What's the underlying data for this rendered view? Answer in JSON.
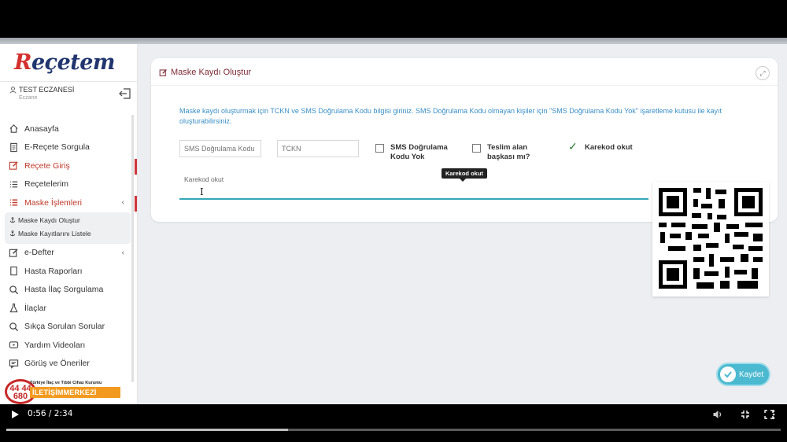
{
  "player": {
    "time_text": "0:56 / 2:34",
    "progress_fraction": 0.364
  },
  "app": {
    "logo_r": "R",
    "logo_rest": "eçetem"
  },
  "user": {
    "name": "TEST ECZANESİ",
    "role": "Eczane"
  },
  "menu": {
    "items": [
      {
        "label": "Anasayfa",
        "icon": "home-icon"
      },
      {
        "label": "E-Reçete Sorgula",
        "icon": "document-icon"
      },
      {
        "label": "Reçete Giriş",
        "icon": "edit-icon"
      },
      {
        "label": "Reçetelerim",
        "icon": "list-icon"
      },
      {
        "label": "Maske İşlemleri",
        "icon": "list-icon"
      },
      {
        "label": "e-Defter",
        "icon": "edit-icon"
      },
      {
        "label": "Hasta Raporları",
        "icon": "document-icon"
      },
      {
        "label": "Hasta İlaç Sorgulama",
        "icon": "search-icon"
      },
      {
        "label": "İlaçlar",
        "icon": "flask-icon"
      },
      {
        "label": "Sıkça Sorulan Sorular",
        "icon": "search-icon"
      },
      {
        "label": "Yardım Videoları",
        "icon": "video-icon"
      },
      {
        "label": "Görüş ve Öneriler",
        "icon": "chat-icon"
      }
    ],
    "submenu": [
      {
        "label": "Maske Kaydı Oluştur"
      },
      {
        "label": "Maske Kayıtlarını Listele"
      }
    ]
  },
  "contact": {
    "number_top": "44 44",
    "number_bottom": "680",
    "tagline": "Türkiye İlaç ve Tıbbi Cihaz Kurumu",
    "label": "İLETİŞİMMERKEZİ"
  },
  "card": {
    "title": "Maske Kaydı Oluştur",
    "info": "Maske kaydı oluşturmak için TCKN ve SMS Doğrulama Kodu bilgisi giriniz. SMS Doğrulama Kodu olmayan kişiler için \"SMS Doğrulama Kodu Yok\" işaretleme kutusu ile kayıt oluşturabilirsiniz.",
    "sms_placeholder": "SMS Doğrulama Kodu",
    "tckn_placeholder": "TCKN",
    "chk_sms_line1": "SMS Doğrulama",
    "chk_sms_line2": "Kodu Yok",
    "chk_teslim_line1": "Teslim alan",
    "chk_teslim_line2": "başkası mı?",
    "karekod_check_label": "Karekod okut",
    "karekod_field_label": "Karekod okut",
    "tooltip": "Karekod okut"
  },
  "actions": {
    "save_label": "Kaydet"
  },
  "colors": {
    "accent": "#4bb9cf",
    "title": "#7a2a35",
    "info": "#3b8fc4",
    "active": "#c0392b"
  }
}
